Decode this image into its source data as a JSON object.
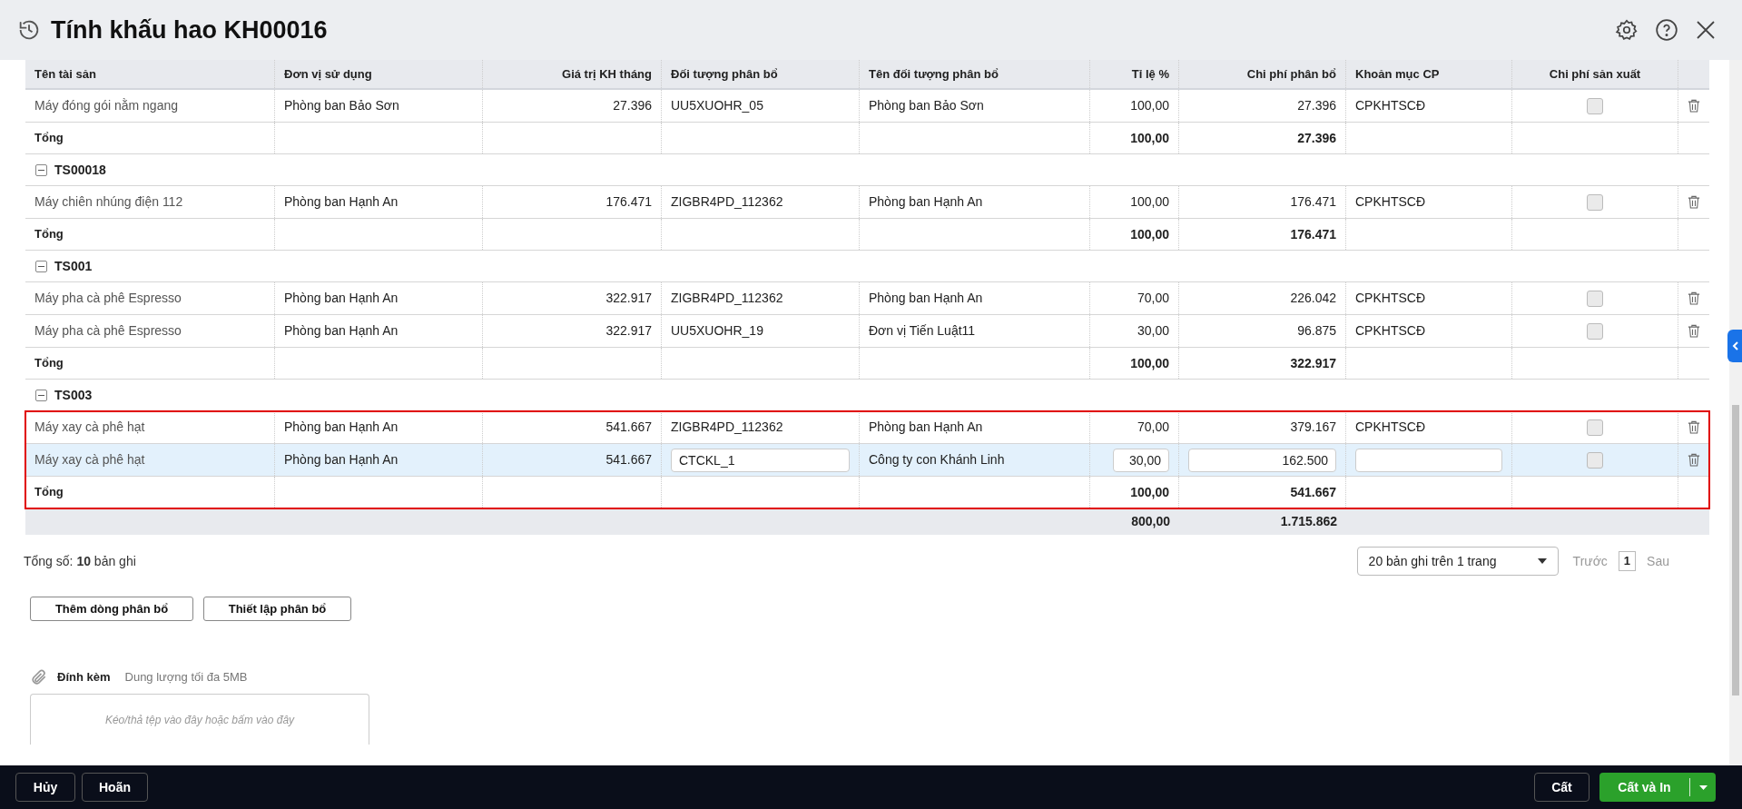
{
  "window": {
    "title": "Tính khấu hao KH00016"
  },
  "table": {
    "columns": [
      "Tên tài sản",
      "Đơn vị sử dụng",
      "Giá trị KH tháng",
      "Đối tượng phân bổ",
      "Tên đối tượng phân bổ",
      "Tỉ lệ %",
      "Chi phí phân bổ",
      "Khoản mục CP",
      "Chi phí sản xuất"
    ],
    "groups": [
      {
        "highlighted": false,
        "rows": [
          {
            "asset": "Máy đóng gói nằm ngang",
            "unit": "Phòng ban Bảo Sơn",
            "value": "27.396",
            "target_code": "UU5XUOHR_05",
            "target_name": "Phòng ban Bảo Sơn",
            "ratio": "100,00",
            "cost": "27.396",
            "account": "CPKHTSCĐ",
            "production": false,
            "selected": false,
            "editing": false
          }
        ],
        "total": {
          "label": "Tổng",
          "ratio": "100,00",
          "cost": "27.396"
        }
      },
      {
        "code": "TS00018",
        "expanded": true,
        "highlighted": false,
        "rows": [
          {
            "asset": "Máy chiên nhúng điện 112",
            "unit": "Phòng ban Hạnh An",
            "value": "176.471",
            "target_code": "ZIGBR4PD_112362",
            "target_name": "Phòng ban Hạnh An",
            "ratio": "100,00",
            "cost": "176.471",
            "account": "CPKHTSCĐ",
            "production": false,
            "selected": false,
            "editing": false
          }
        ],
        "total": {
          "label": "Tổng",
          "ratio": "100,00",
          "cost": "176.471"
        }
      },
      {
        "code": "TS001",
        "expanded": true,
        "highlighted": false,
        "rows": [
          {
            "asset": "Máy pha cà phê Espresso",
            "unit": "Phòng ban Hạnh An",
            "value": "322.917",
            "target_code": "ZIGBR4PD_112362",
            "target_name": "Phòng ban Hạnh An",
            "ratio": "70,00",
            "cost": "226.042",
            "account": "CPKHTSCĐ",
            "production": false,
            "selected": false,
            "editing": false
          },
          {
            "asset": "Máy pha cà phê Espresso",
            "unit": "Phòng ban Hạnh An",
            "value": "322.917",
            "target_code": "UU5XUOHR_19",
            "target_name": "Đơn vị Tiến Luật11",
            "ratio": "30,00",
            "cost": "96.875",
            "account": "CPKHTSCĐ",
            "production": false,
            "selected": false,
            "editing": false
          }
        ],
        "total": {
          "label": "Tổng",
          "ratio": "100,00",
          "cost": "322.917"
        }
      },
      {
        "code": "TS003",
        "expanded": true,
        "highlighted": true,
        "rows": [
          {
            "asset": "Máy xay cà phê hạt",
            "unit": "Phòng ban Hạnh An",
            "value": "541.667",
            "target_code": "ZIGBR4PD_112362",
            "target_name": "Phòng ban Hạnh An",
            "ratio": "70,00",
            "cost": "379.167",
            "account": "CPKHTSCĐ",
            "production": false,
            "selected": false,
            "editing": false
          },
          {
            "asset": "Máy xay cà phê hạt",
            "unit": "Phòng ban Hạnh An",
            "value": "541.667",
            "target_code": "CTCKL_1",
            "target_name": "Công ty con Khánh Linh",
            "ratio": "30,00",
            "cost": "162.500",
            "production": false,
            "selected": true,
            "editing": true
          }
        ],
        "total": {
          "label": "Tổng",
          "ratio": "100,00",
          "cost": "541.667"
        }
      }
    ],
    "grand_total": {
      "ratio": "800,00",
      "cost": "1.715.862"
    }
  },
  "record_count": "Tổng số: **10** bản ghi",
  "pagination": {
    "page_size": "20 bản ghi trên 1 trang",
    "prev": "Trước",
    "page": "1",
    "next": "Sau"
  },
  "actions": [
    "Thêm dòng phân bổ",
    "Thiết lập phân bổ"
  ],
  "attachment": {
    "label": "Đính kèm",
    "hint": "Dung lượng tối đa 5MB",
    "dropzone": "Kéo/thả tệp vào đây hoặc bấm vào đây"
  },
  "footer": {
    "left_buttons": [
      "Hủy",
      "Hoãn"
    ],
    "save": "Cất",
    "save_print": "Cất và In"
  }
}
